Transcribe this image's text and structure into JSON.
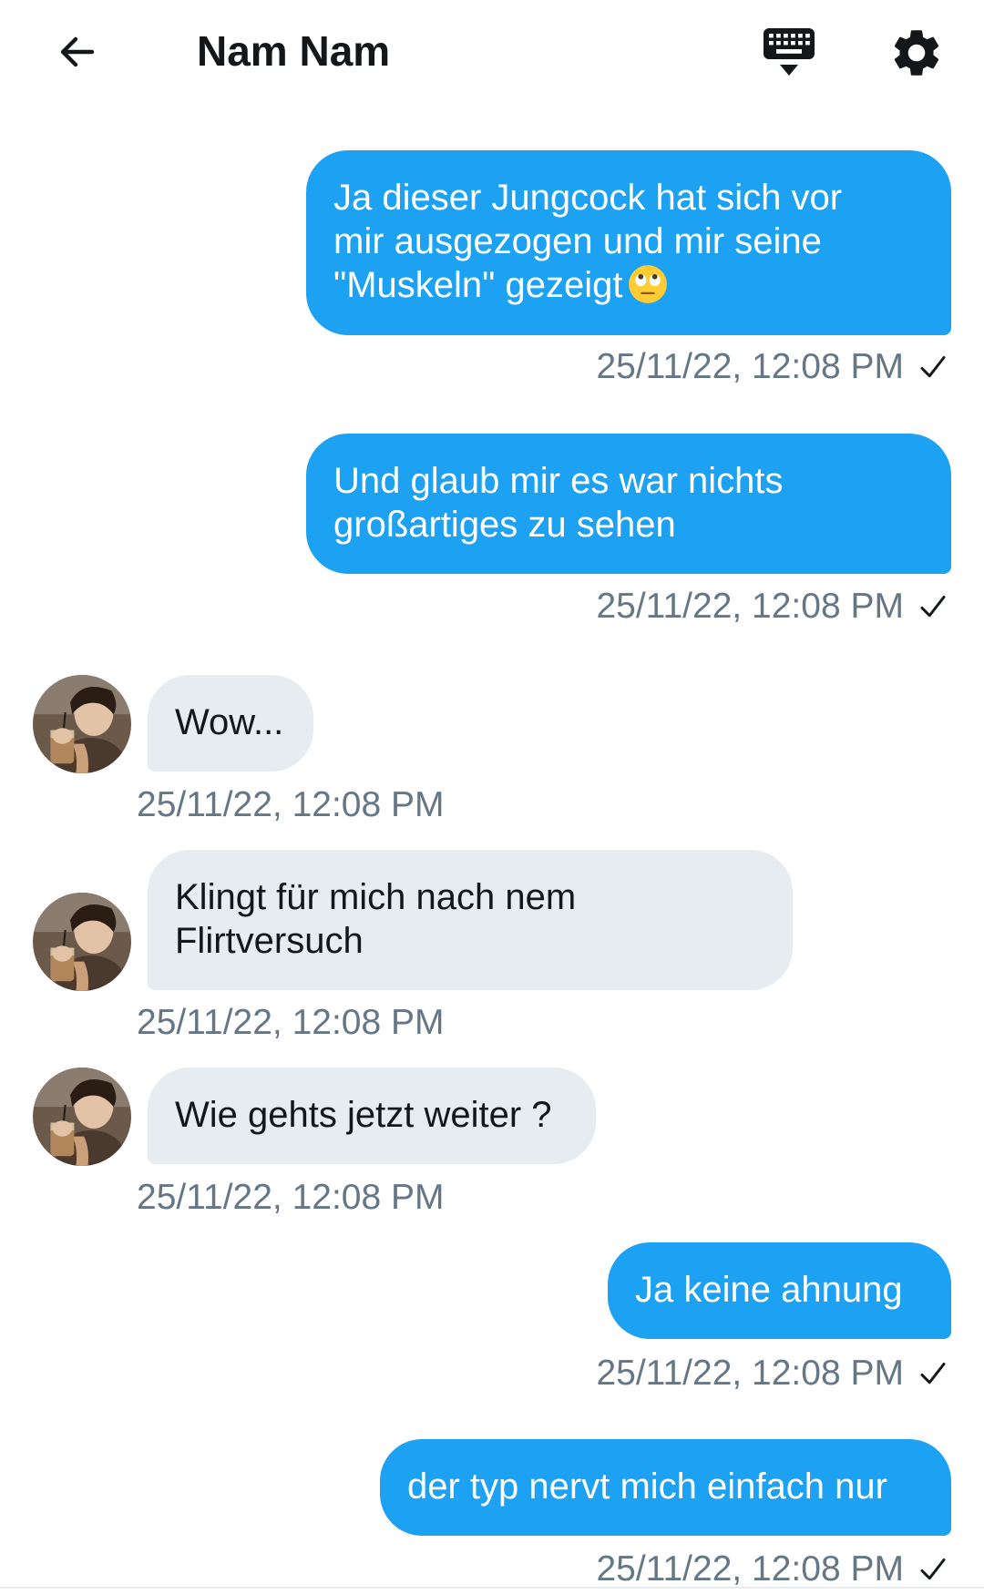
{
  "header": {
    "title": "Nam Nam",
    "back_icon": "arrow-left-icon",
    "keyboard_icon": "keyboard-icon",
    "settings_icon": "gear-icon"
  },
  "colors": {
    "outgoing_bubble": "#1da1f2",
    "incoming_bubble": "#e6ecf0",
    "timestamp": "#657786",
    "text": "#14171a"
  },
  "messages": [
    {
      "direction": "outgoing",
      "lines": [
        "Ja dieser Jungcock hat sich vor",
        "mir ausgezogen und mir seine",
        "\"Muskeln\" gezeigt"
      ],
      "emoji": "face-with-rolling-eyes",
      "timestamp": "25/11/22, 12:08 PM",
      "status": "sent"
    },
    {
      "direction": "outgoing",
      "lines": [
        "Und glaub mir es war nichts",
        "großartiges zu sehen"
      ],
      "timestamp": "25/11/22, 12:08 PM",
      "status": "sent"
    },
    {
      "direction": "incoming",
      "lines": [
        "Wow..."
      ],
      "timestamp": "25/11/22, 12:08 PM"
    },
    {
      "direction": "incoming",
      "lines": [
        "Klingt für mich nach nem",
        "Flirtversuch"
      ],
      "timestamp": "25/11/22, 12:08 PM"
    },
    {
      "direction": "incoming",
      "lines": [
        "Wie gehts jetzt weiter ?"
      ],
      "timestamp": "25/11/22, 12:08 PM"
    },
    {
      "direction": "outgoing",
      "lines": [
        "Ja keine ahnung"
      ],
      "timestamp": "25/11/22, 12:08 PM",
      "status": "sent"
    },
    {
      "direction": "outgoing",
      "lines": [
        "der typ nervt mich einfach nur"
      ],
      "timestamp": "25/11/22, 12:08 PM",
      "status": "sent"
    }
  ]
}
